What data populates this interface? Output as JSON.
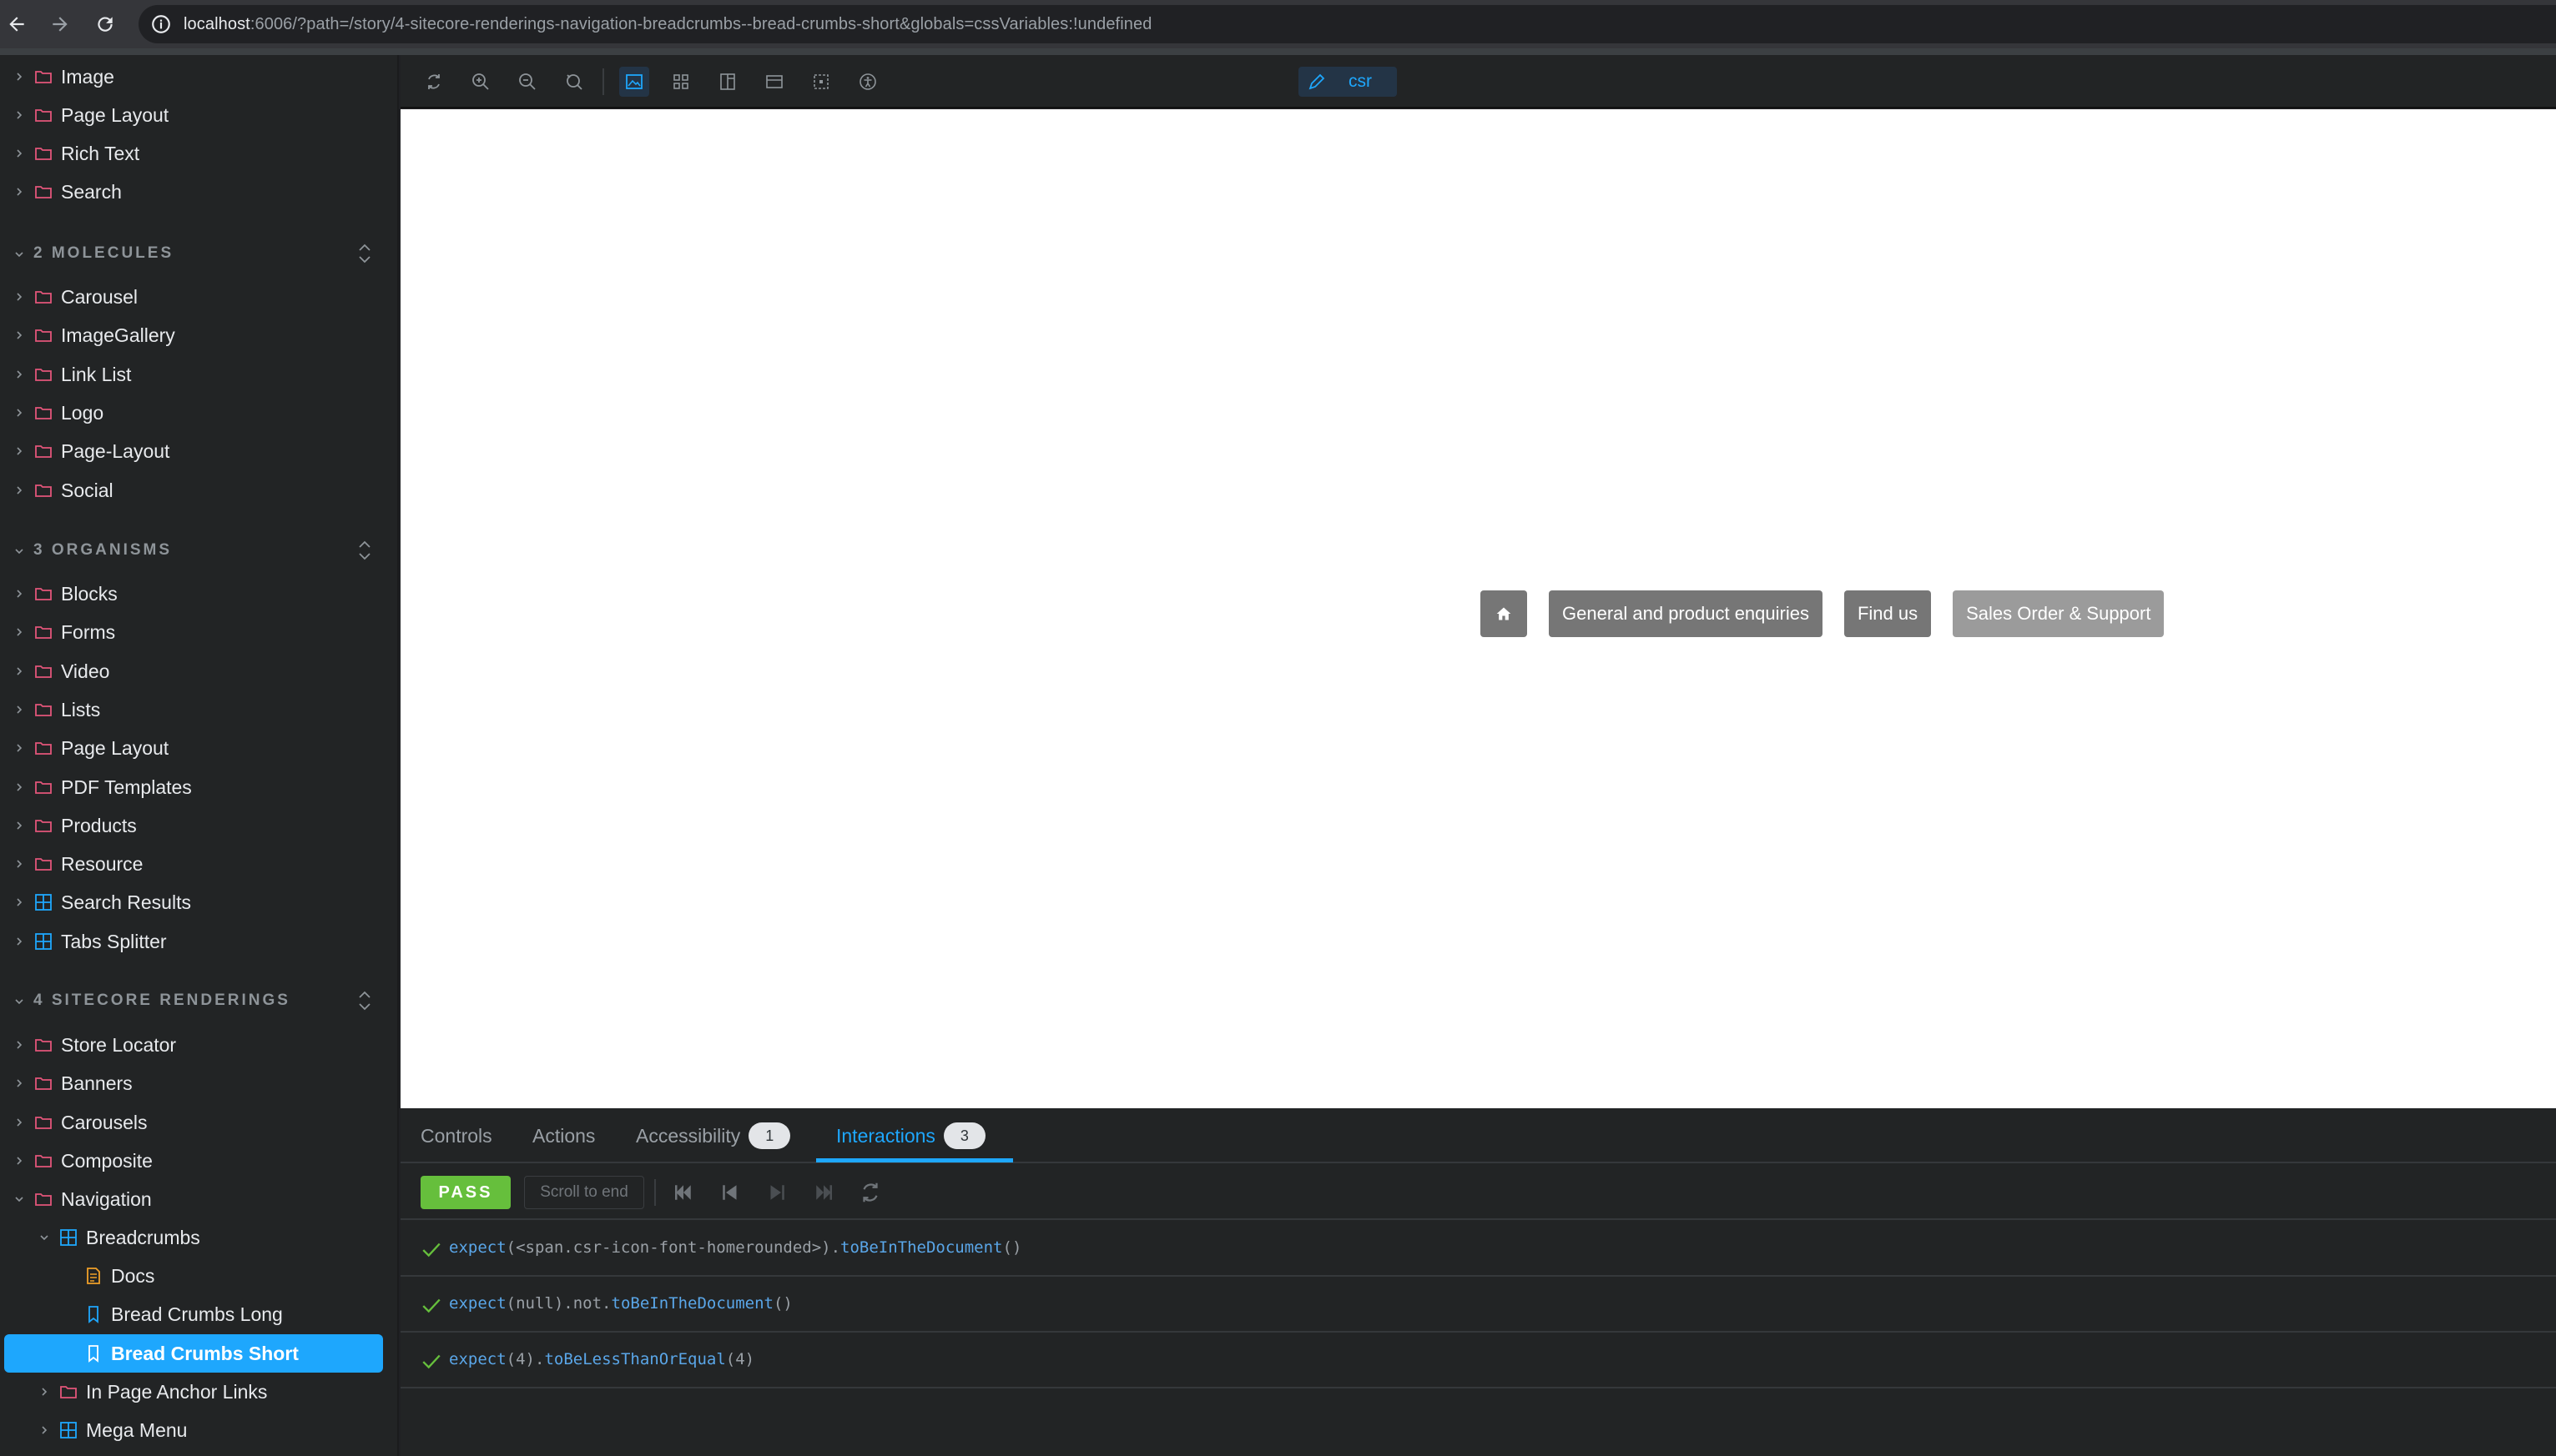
{
  "browser": {
    "url_host": "localhost",
    "url_rest": ":6006/?path=/story/4-sitecore-renderings-navigation-breadcrumbs--bread-crumbs-short&globals=cssVariables:!undefined"
  },
  "sidebar": {
    "group1_items": [
      "Image",
      "Page Layout",
      "Rich Text",
      "Search"
    ],
    "section2": "2 MOLECULES",
    "group2_items": [
      "Carousel",
      "ImageGallery",
      "Link List",
      "Logo",
      "Page-Layout",
      "Social"
    ],
    "section3": "3 ORGANISMS",
    "group3_items": [
      "Blocks",
      "Forms",
      "Video",
      "Lists",
      "Page Layout",
      "PDF Templates",
      "Products",
      "Resource",
      "Search Results",
      "Tabs Splitter"
    ],
    "section4": "4 SITECORE RENDERINGS",
    "group4_items": [
      "Store Locator",
      "Banners",
      "Carousels",
      "Composite",
      "Navigation"
    ],
    "breadcrumbs": "Breadcrumbs",
    "docs": "Docs",
    "long": "Bread Crumbs Long",
    "short": "Bread Crumbs Short",
    "anchor": "In Page Anchor Links",
    "mega": "Mega Menu"
  },
  "toolbar": {
    "csr_label": "csr"
  },
  "breadcrumb": {
    "items": [
      "General and product enquiries",
      "Find us",
      "Sales Order & Support"
    ]
  },
  "panel": {
    "tabs": {
      "controls": "Controls",
      "actions": "Actions",
      "accessibility": "Accessibility",
      "accessibility_count": "1",
      "interactions": "Interactions",
      "interactions_count": "3"
    },
    "status": "PASS",
    "scroll_to_end": "Scroll to end",
    "interactions": [
      {
        "expect": "expect",
        "open": "(",
        "arg": "<span.csr-icon-font-homerounded>",
        "close": ").",
        "matcher": "toBeInTheDocument",
        "tail": "()"
      },
      {
        "expect": "expect",
        "open": "(",
        "arg": "null",
        "close": ").not.",
        "matcher": "toBeInTheDocument",
        "tail": "()"
      },
      {
        "expect": "expect",
        "open": "(",
        "arg": "4",
        "close": ").",
        "matcher": "toBeLessThanOrEqual",
        "tail": "(4)"
      }
    ],
    "colors": {
      "accent": "#1ea7fd",
      "pass": "#66bf3c"
    }
  }
}
